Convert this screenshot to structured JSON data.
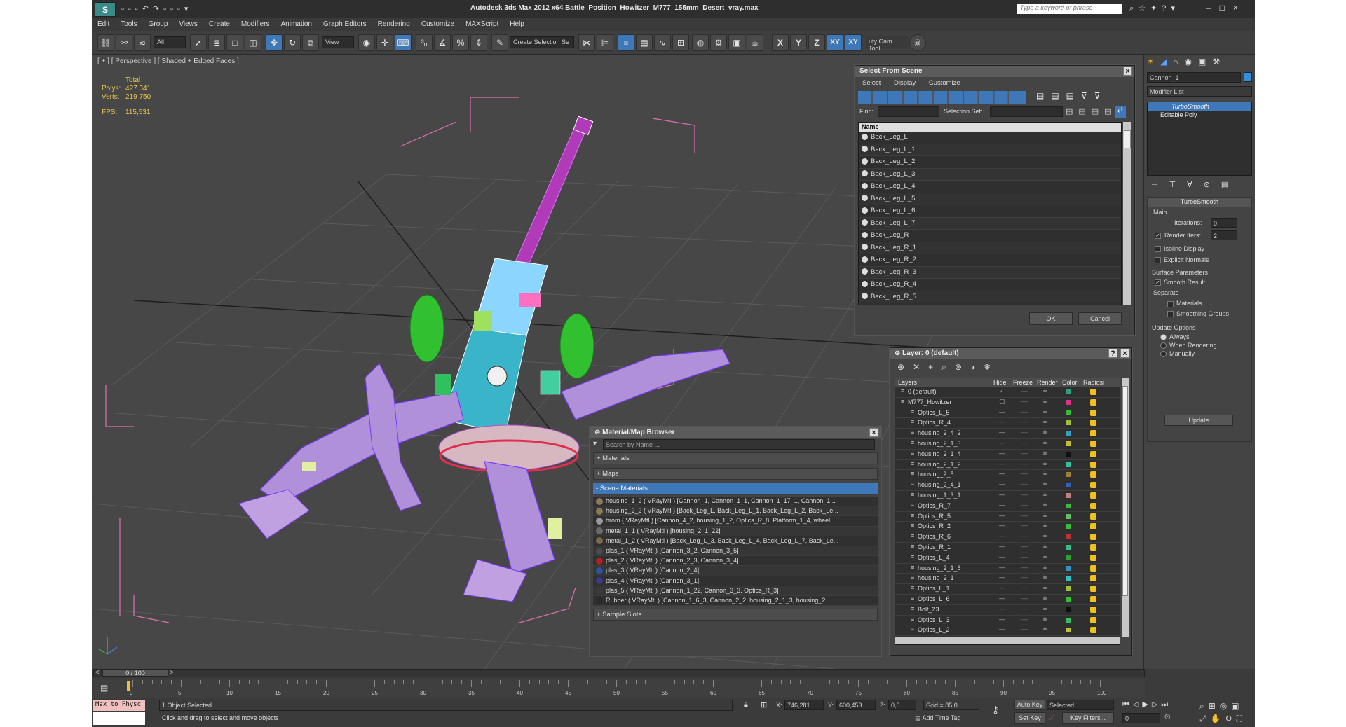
{
  "window": {
    "title": "Autodesk 3ds Max  2012 x64      Battle_Position_Howitzer_M777_155mm_Desert_vray.max",
    "search_placeholder": "Type a keyword or phrase"
  },
  "menu": [
    "Edit",
    "Tools",
    "Group",
    "Views",
    "Create",
    "Modifiers",
    "Animation",
    "Graph Editors",
    "Rendering",
    "Customize",
    "MAXScript",
    "Help"
  ],
  "toolbar": {
    "filter": "All",
    "ref_coord": "View",
    "named_sel": "Create Selection Se",
    "cam_tool": "uty Cam Tool",
    "axes": [
      "X",
      "Y",
      "Z",
      "XY",
      "XY"
    ]
  },
  "viewport": {
    "label": "[ + ] [ Perspective ] [ Shaded + Edged Faces ]",
    "stats": {
      "header": "Total",
      "polys_label": "Polys:",
      "polys": "427 341",
      "verts_label": "Verts:",
      "verts": "219 750",
      "fps_label": "FPS:",
      "fps": "115,531"
    }
  },
  "select_from_scene": {
    "title": "Select From Scene",
    "menu": [
      "Select",
      "Display",
      "Customize"
    ],
    "find_label": "Find:",
    "selset_label": "Selection Set:",
    "col_name": "Name",
    "items": [
      "Back_Leg_L",
      "Back_Leg_L_1",
      "Back_Leg_L_2",
      "Back_Leg_L_3",
      "Back_Leg_L_4",
      "Back_Leg_L_5",
      "Back_Leg_L_6",
      "Back_Leg_L_7",
      "Back_Leg_R",
      "Back_Leg_R_1",
      "Back_Leg_R_2",
      "Back_Leg_R_3",
      "Back_Leg_R_4",
      "Back_Leg_R_5"
    ],
    "ok": "OK",
    "cancel": "Cancel"
  },
  "material_browser": {
    "title": "Material/Map Browser",
    "search_placeholder": "Search by Name ...",
    "groups": [
      "+ Materials",
      "+ Maps",
      "- Scene Materials",
      "+ Sample Slots"
    ],
    "materials": [
      {
        "text": "housing_1_2  ( VRayMtl )  [Cannon_1, Cannon_1_1, Cannon_1_17_1, Cannon_1...",
        "color": "#8a7a5a"
      },
      {
        "text": "housing_2_2  ( VRayMtl )  [Back_Leg_L, Back_Leg_L_1, Back_Leg_L_2, Back_Le...",
        "color": "#8a7a5a"
      },
      {
        "text": "hrom  ( VRayMtl )  [Cannon_4_2, housing_1_2, Optics_R_8, Platform_1_4, wheel...",
        "color": "#9a9a9a"
      },
      {
        "text": "metal_1_1  ( VRayMtl )  [housing_2_1_22]",
        "color": "#6a6a6a"
      },
      {
        "text": "metal_1_2  ( VRayMtl )  [Back_Leg_L_3, Back_Leg_L_4, Back_Leg_L_7, Back_Le...",
        "color": "#7a6a4a"
      },
      {
        "text": "plas_1  ( VRayMtl )  [Cannon_3_2, Cannon_3_5]",
        "color": "#4a4a4a"
      },
      {
        "text": "plas_2  ( VRayMtl )  [Cannon_2_3, Cannon_3_4]",
        "color": "#b02020"
      },
      {
        "text": "plas_3  ( VRayMtl )  [Cannon_2_4]",
        "color": "#3050a0"
      },
      {
        "text": "plas_4  ( VRayMtl )  [Cannon_3_1]",
        "color": "#3a3a8a"
      },
      {
        "text": "plas_5  ( VRayMtl )  [Cannon_1_22, Cannon_3_3, Optics_R_3]",
        "color": "#3a3a3a"
      },
      {
        "text": "Rubber  ( VRayMtl )  [Cannon_1_6_3, Cannon_2_2, housing_2_1_3, housing_2...",
        "color": "#2a2a2a"
      }
    ]
  },
  "layer_dialog": {
    "title": "Layer: 0 (default)",
    "cols": [
      "Layers",
      "Hide",
      "Freeze",
      "Render",
      "Color",
      "Radiosi"
    ],
    "layers": [
      {
        "name": "0 (default)",
        "indent": 1,
        "color": "#2aa080"
      },
      {
        "name": "M777_Howitzer",
        "indent": 1,
        "color": "#e0308a"
      },
      {
        "name": "Optics_L_5",
        "indent": 2,
        "color": "#30c030"
      },
      {
        "name": "Optics_R_4",
        "indent": 2,
        "color": "#a0c030"
      },
      {
        "name": "housing_2_4_2",
        "indent": 2,
        "color": "#30a0c0"
      },
      {
        "name": "housing_2_1_3",
        "indent": 2,
        "color": "#c0c030"
      },
      {
        "name": "housing_2_1_4",
        "indent": 2,
        "color": "#101010"
      },
      {
        "name": "housing_2_1_2",
        "indent": 2,
        "color": "#30c0a0"
      },
      {
        "name": "housing_2_5",
        "indent": 2,
        "color": "#a08030"
      },
      {
        "name": "housing_2_4_1",
        "indent": 2,
        "color": "#3060c0"
      },
      {
        "name": "housing_1_3_1",
        "indent": 2,
        "color": "#c08080"
      },
      {
        "name": "Optics_R_7",
        "indent": 2,
        "color": "#30c030"
      },
      {
        "name": "Optics_R_5",
        "indent": 2,
        "color": "#60c060"
      },
      {
        "name": "Optics_R_2",
        "indent": 2,
        "color": "#30c030"
      },
      {
        "name": "Optics_R_6",
        "indent": 2,
        "color": "#c03030"
      },
      {
        "name": "Optics_R_1",
        "indent": 2,
        "color": "#30c080"
      },
      {
        "name": "Optics_L_4",
        "indent": 2,
        "color": "#30a030"
      },
      {
        "name": "housing_2_1_6",
        "indent": 2,
        "color": "#3090c0"
      },
      {
        "name": "housing_2_1",
        "indent": 2,
        "color": "#30c0c0"
      },
      {
        "name": "Optics_L_1",
        "indent": 2,
        "color": "#a0c030"
      },
      {
        "name": "Optics_L_6",
        "indent": 2,
        "color": "#30c030"
      },
      {
        "name": "Bolt_23",
        "indent": 2,
        "color": "#101010"
      },
      {
        "name": "Optics_L_3",
        "indent": 2,
        "color": "#30c060"
      },
      {
        "name": "Optics_L_2",
        "indent": 2,
        "color": "#c0c030"
      }
    ]
  },
  "command_panel": {
    "object_name": "Cannon_1",
    "modifier_list": "Modifier List",
    "stack": [
      "TurboSmooth",
      "Editable Poly"
    ],
    "rollout_title": "TurboSmooth",
    "main_label": "Main",
    "iterations_label": "Iterations:",
    "iterations": "0",
    "render_iters_label": "Render Iters:",
    "render_iters": "2",
    "isoline": "Isoline Display",
    "explicit": "Explicit Normals",
    "surface_label": "Surface Parameters",
    "smooth_result": "Smooth Result",
    "separate_label": "Separate",
    "sep_materials": "Materials",
    "sep_smoothing": "Smoothing Groups",
    "update_label": "Update Options",
    "always": "Always",
    "when_rendering": "When Rendering",
    "manually": "Manually",
    "update_btn": "Update"
  },
  "timeline": {
    "frame": "0 / 100",
    "ticks": [
      "0",
      "5",
      "10",
      "15",
      "20",
      "25",
      "30",
      "35",
      "40",
      "45",
      "50",
      "55",
      "60",
      "65",
      "70",
      "75",
      "80",
      "85",
      "90",
      "95",
      "100"
    ]
  },
  "status": {
    "maxscript": "Max to Physc",
    "selected": "1 Object Selected",
    "prompt": "Click and drag to select and move objects",
    "x_label": "X:",
    "x": "746,281",
    "y_label": "Y:",
    "y": "600,453",
    "z_label": "Z:",
    "z": "0,0",
    "grid": "Grid = 85,0",
    "add_time_tag": "Add Time Tag",
    "auto_key": "Auto Key",
    "auto_key_value": "Selected",
    "set_key": "Set Key",
    "key_filters": "Key Filters...",
    "frame_field": "0"
  }
}
